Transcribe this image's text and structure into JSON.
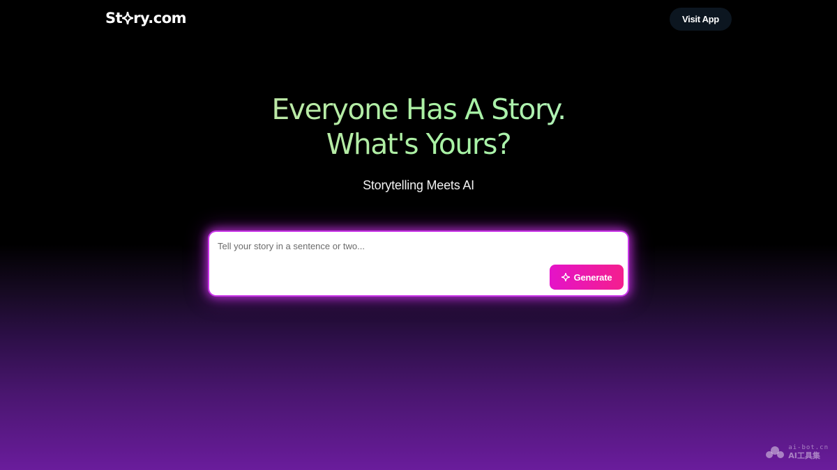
{
  "nav": {
    "logo_prefix": "St",
    "logo_suffix": "ry.com",
    "visit_button_label": "Visit App"
  },
  "hero": {
    "headline_line1": "Everyone Has A Story.",
    "headline_line2": "What's Yours?",
    "tagline": "Storytelling Meets AI"
  },
  "prompt": {
    "placeholder": "Tell your story in a sentence or two...",
    "value": "",
    "generate_label": "Generate",
    "generate_icon": "sparkle-icon"
  },
  "watermark": {
    "line1": "ai-bot.cn",
    "line2": "AI工具集"
  },
  "colors": {
    "accent_magenta": "#e413c8",
    "accent_pink": "#f41f8e",
    "glow": "#c935e8",
    "headline_green": "#a7f2a4",
    "button_dark": "#0c1620"
  }
}
